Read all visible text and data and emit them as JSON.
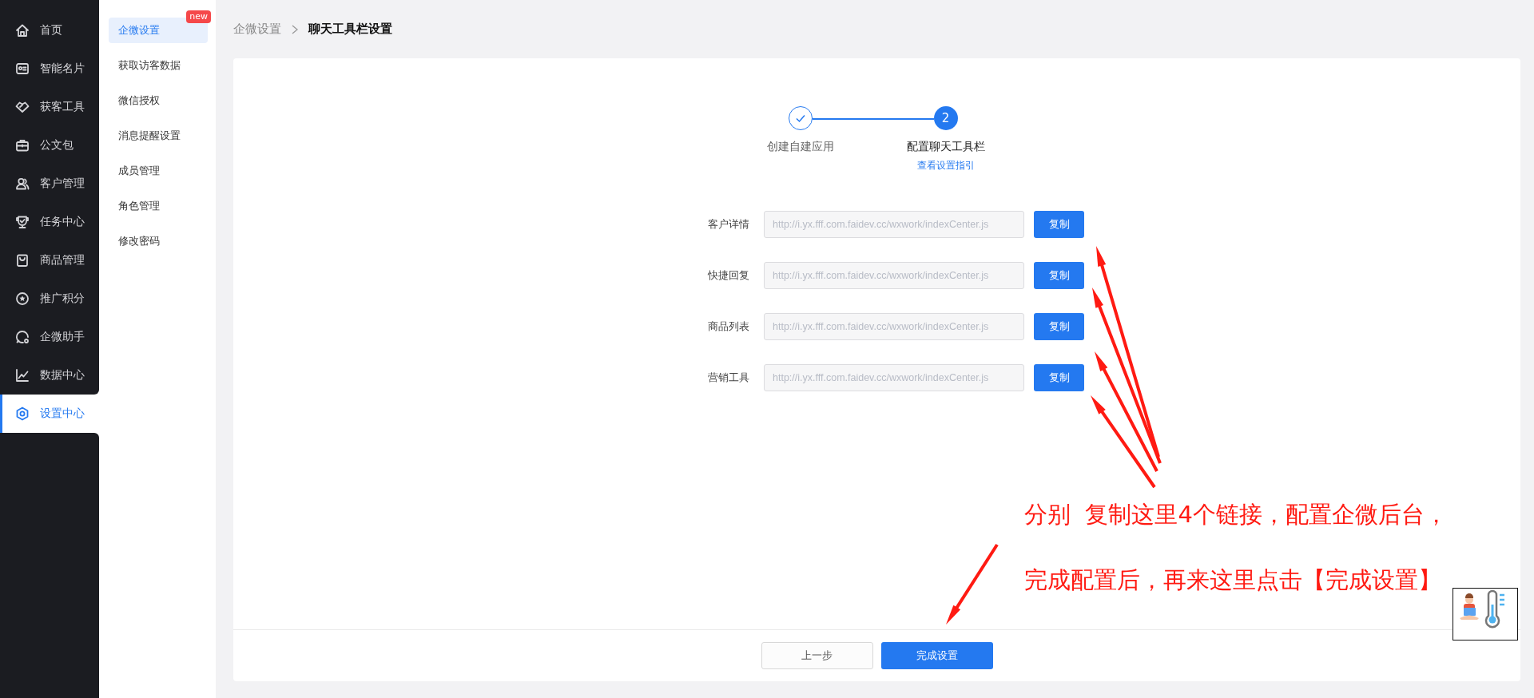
{
  "nav": [
    {
      "label": "首页",
      "selected": false
    },
    {
      "label": "智能名片",
      "selected": false
    },
    {
      "label": "获客工具",
      "selected": false
    },
    {
      "label": "公文包",
      "selected": false
    },
    {
      "label": "客户管理",
      "selected": false
    },
    {
      "label": "任务中心",
      "selected": false
    },
    {
      "label": "商品管理",
      "selected": false
    },
    {
      "label": "推广积分",
      "selected": false
    },
    {
      "label": "企微助手",
      "selected": false
    },
    {
      "label": "数据中心",
      "selected": false
    },
    {
      "label": "设置中心",
      "selected": true
    }
  ],
  "subnav": [
    {
      "label": "企微设置",
      "selected": true,
      "badge": "new"
    },
    {
      "label": "获取访客数据",
      "selected": false
    },
    {
      "label": "微信授权",
      "selected": false
    },
    {
      "label": "消息提醒设置",
      "selected": false
    },
    {
      "label": "成员管理",
      "selected": false
    },
    {
      "label": "角色管理",
      "selected": false
    },
    {
      "label": "修改密码",
      "selected": false
    }
  ],
  "breadcrumb": {
    "parent": "企微设置",
    "current": "聊天工具栏设置"
  },
  "steps": [
    {
      "label": "创建自建应用",
      "done": true
    },
    {
      "label": "配置聊天工具栏",
      "done": false,
      "number": "2",
      "link": "查看设置指引"
    }
  ],
  "fields": [
    {
      "label": "客户详情",
      "value": "http://i.yx.fff.com.faidev.cc/wxwork/indexCenter.js",
      "button": "复制"
    },
    {
      "label": "快捷回复",
      "value": "http://i.yx.fff.com.faidev.cc/wxwork/indexCenter.js",
      "button": "复制"
    },
    {
      "label": "商品列表",
      "value": "http://i.yx.fff.com.faidev.cc/wxwork/indexCenter.js",
      "button": "复制"
    },
    {
      "label": "营销工具",
      "value": "http://i.yx.fff.com.faidev.cc/wxwork/indexCenter.js",
      "button": "复制"
    }
  ],
  "footer": {
    "back": "上一步",
    "finish": "完成设置"
  },
  "annotation": {
    "lines": [
      "分别  复制这里4个链接，配置企微后台，",
      "完成配置后，再来这里点击【完成设置】"
    ]
  }
}
